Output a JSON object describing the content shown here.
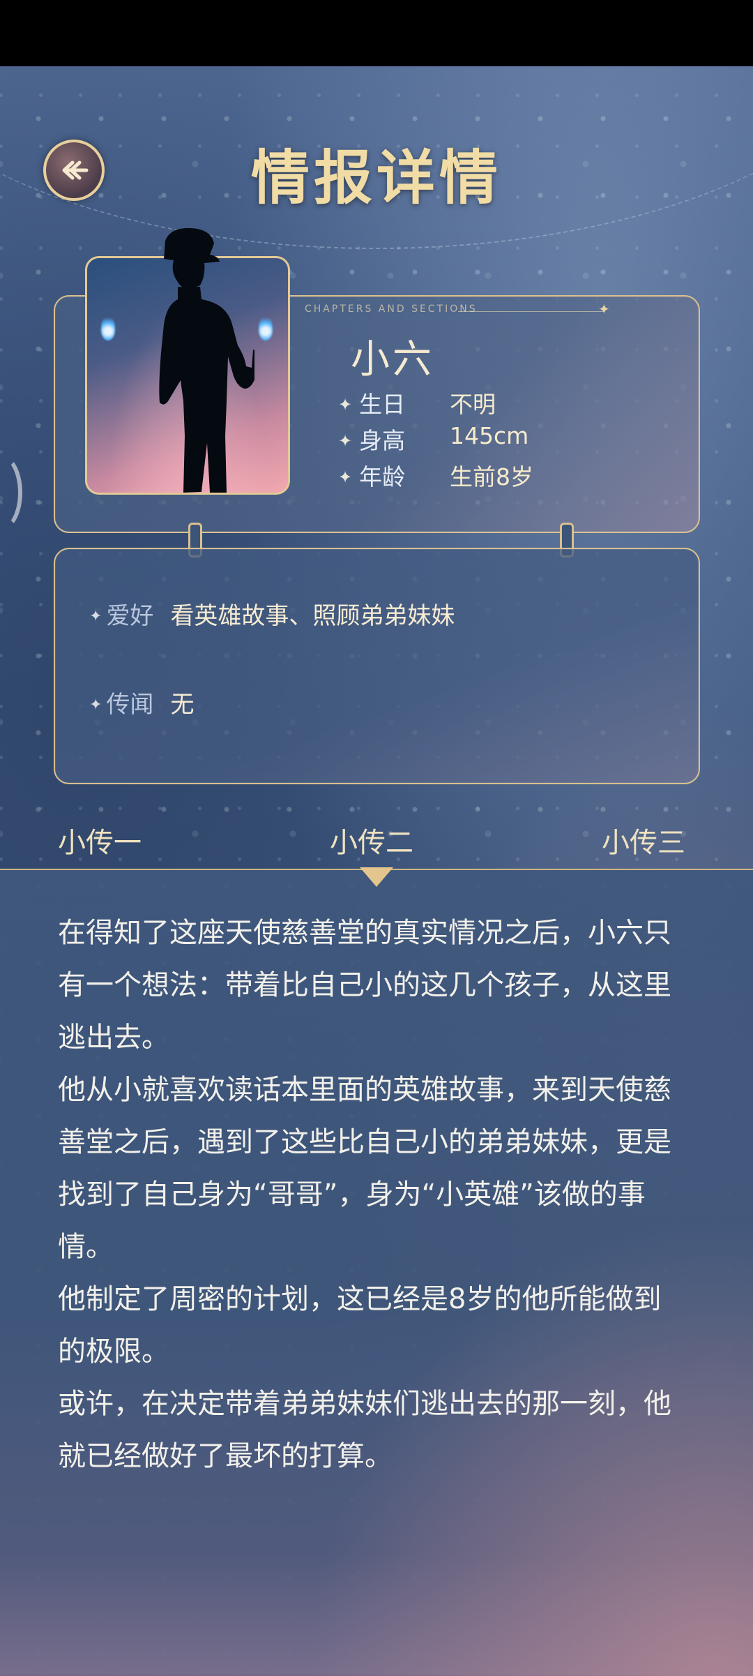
{
  "page": {
    "title": "情报详情",
    "back_icon": "back-arrow-icon",
    "colors": {
      "gold": "#e9d4a2",
      "panel_border": "#d9c08e",
      "text_light": "#f2f0ea"
    }
  },
  "profile": {
    "chapter_label": "CHAPTERS AND SECTIONS",
    "name": "小六",
    "fields": [
      {
        "label": "生日",
        "value": "不明"
      },
      {
        "label": "身高",
        "value": "145cm"
      },
      {
        "label": "年龄",
        "value": "生前8岁"
      }
    ]
  },
  "details": {
    "hobby_label": "爱好",
    "hobby_value": "看英雄故事、照顾弟弟妹妹",
    "rumor_label": "传闻",
    "rumor_value": "无"
  },
  "tabs": [
    {
      "label": "小传一"
    },
    {
      "label": "小传二",
      "selected": true
    },
    {
      "label": "小传三"
    }
  ],
  "story": {
    "paragraphs": [
      "在得知了这座天使慈善堂的真实情况之后，小六只有一个想法：带着比自己小的这几个孩子，从这里逃出去。",
      "他从小就喜欢读话本里面的英雄故事，来到天使慈善堂之后，遇到了这些比自己小的弟弟妹妹，更是找到了自己身为“哥哥”，身为“小英雄”该做的事情。",
      "他制定了周密的计划，这已经是8岁的他所能做到的极限。",
      "或许，在决定带着弟弟妹妹们逃出去的那一刻，他就已经做好了最坏的打算。"
    ]
  }
}
